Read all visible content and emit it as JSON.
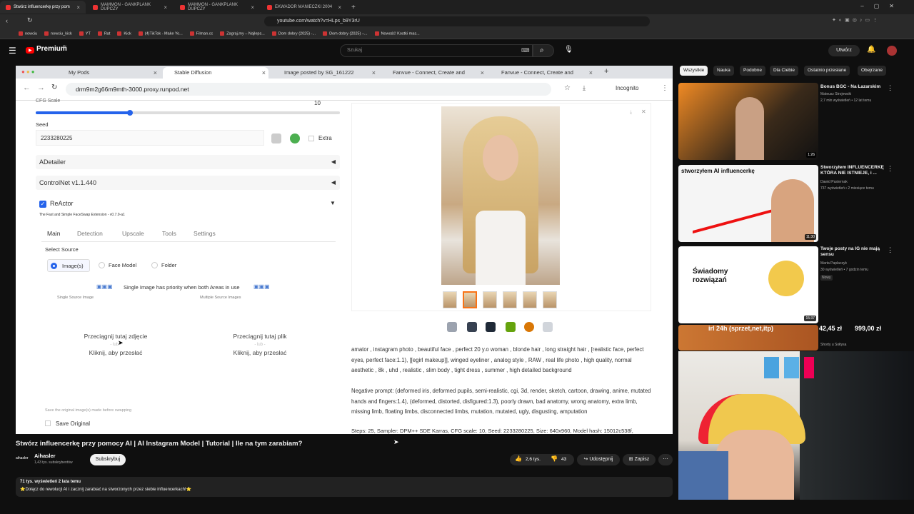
{
  "outer_browser": {
    "tabs": [
      "Stwórz influencerkę przy pom",
      "MAMMON - GANKPLANK DUPCZY",
      "MAMMON - GANKPLANK DUPCZY",
      "EKWADOR MANIECZKI 2004"
    ],
    "url": "youtube.com/watch?v=HLps_b9Y3rU",
    "bookmarks": [
      "nowciu",
      "nowciu_kick",
      "YT",
      "Rat",
      "Kick",
      "(4)TikTok - Make Yo...",
      "Filman.cc",
      "Zagraj.my – Najleps...",
      "Dom dobry (2025) -...",
      "Dom dobry (2025) –...",
      "Nowość! Kostki mas..."
    ]
  },
  "youtube": {
    "logo_text": "Premium",
    "logo_superscript": "PL",
    "search_placeholder": "Szukaj",
    "create_label": "Utwórz",
    "video_title": "Stwórz influencerkę przy pomocy AI | AI Instagram Model | Tutorial | Ile na tym zarabiam?",
    "channel_name": "Aihasler",
    "channel_logo_text": "aihasler",
    "subscribers": "1,43 tys. subskrybentów",
    "subscribe_label": "Subskrybuj",
    "likes": "2,6 tys.",
    "dislikes": "43",
    "share_label": "Udostępnij",
    "save_label": "Zapisz",
    "views_date": "71 tys. wyświetleń  2 lata temu",
    "description": "⭐Dołącz do rewolucji AI i zacznij zarabiać na stworzonych przez siebie influencerkach!⭐",
    "chips": [
      "Wszystkie",
      "Nauka",
      "Podobne",
      "Dla Ciebie",
      "Ostatnio przesłane",
      "Obejrzane"
    ],
    "recommendations": [
      {
        "title": "Bonus BGC - Na Łazarskim",
        "channel": "Mateusz Strojewski",
        "meta": "2,7 mln wyświetleń • 12 lat temu",
        "duration": "1:26",
        "thumb_text": ""
      },
      {
        "title": "Stworzyłem INFLUENCERKĘ KTÓRA NIE ISTNIEJE, i ...",
        "channel": "Dawid Pasternak",
        "meta": "737 wyświetleń • 2 miesiące temu",
        "duration": "11:30",
        "thumb_text": "stworzyłem AI influencerkę"
      },
      {
        "title": "Twoje posty na IG nie mają sensu",
        "channel": "Marta Paplaczyk",
        "meta": "30 wyświetleń • 7 godzin temu",
        "badge": "Nowy",
        "duration": "15:37",
        "thumb_text": "Świadomy rozwiązań"
      },
      {
        "title": "",
        "channel": "Shorty u Sołtysa",
        "meta": "",
        "duration": "",
        "thumb_text": "irl 24h (sprzet,net,itp)",
        "price1": "42,45 zł",
        "price2": "999,00 zł"
      }
    ]
  },
  "inner_browser": {
    "tabs": [
      "My Pods",
      "Stable Diffusion",
      "Image posted by SG_161222",
      "Fanvue - Connect, Create and",
      "Fanvue - Connect, Create and"
    ],
    "url": "drm9m2g66m9mth-3000.proxy.runpod.net",
    "incognito": "Incognito"
  },
  "sd": {
    "cfg_label": "CFG Scale",
    "cfg_value": "10",
    "cfg_slider_fraction": 0.31,
    "seed_label": "Seed",
    "seed_value": "2233280225",
    "extra_label": "Extra",
    "adetailer": "ADetailer",
    "controlnet": "ControlNet v1.1.440",
    "reactor": "ReActor",
    "reactor_sub": "The Fast and Simple FaceSwap Extension - v0.7.0-a1",
    "subtabs": [
      "Main",
      "Detection",
      "Upscale",
      "Tools",
      "Settings"
    ],
    "select_source": "Select Source",
    "source_options": [
      "Image(s)",
      "Face Model",
      "Folder"
    ],
    "priority_note": "Single Image has priority when both Areas in use",
    "single_source": "Single Source Image",
    "multiple_source": "Multiple Source Images",
    "drop1": [
      "Przeciągnij tutaj zdjęcie",
      "- lub -",
      "Kliknij, aby przesłać"
    ],
    "drop2": [
      "Przeciągnij tutaj plik",
      "- lub -",
      "Kliknij, aby przesłać"
    ],
    "save_original_note": "Save the original image(s) made before swapping",
    "save_original": "Save Original",
    "prompt": "amator , instagram photo , beautiful face , perfect 20 y.o woman , blonde hair , long straight hair , [realistic face, perfect eyes, perfect face:1.1), [[egirl makeup]], winged eyeliner , analog style , RAW , real life photo , high quality, normal aesthetic , 8k , uhd , realistic , slim body , tight dress , summer , high detailed background",
    "negative": "Negative prompt: (deformed iris, deformed pupils, semi-realistic, cgi, 3d, render, sketch, cartoon, drawing, anime, mutated hands and fingers:1.4), (deformed, distorted, disfigured:1.3), poorly drawn, bad anatomy, wrong anatomy, extra limb, missing limb, floating limbs, disconnected limbs, mutation, mutated, ugly, disgusting, amputation",
    "steps": "Steps: 25, Sampler: DPM++ SDE Karras, CFG scale: 10, Seed: 2233280225, Size: 640x960, Model hash: 15012c538f,"
  }
}
